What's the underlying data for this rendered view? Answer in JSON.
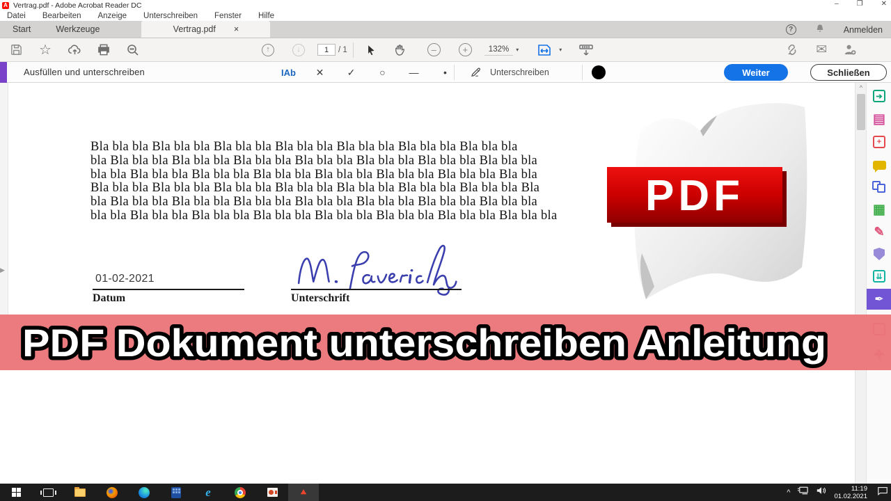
{
  "window": {
    "title": "Vertrag.pdf - Adobe Acrobat Reader DC",
    "logo_letter": "A",
    "minimize_glyph": "–",
    "restore_glyph": "❐",
    "close_glyph": "✕"
  },
  "menu_bar": {
    "items": [
      "Datei",
      "Bearbeiten",
      "Anzeige",
      "Unterschreiben",
      "Fenster",
      "Hilfe"
    ]
  },
  "tab_bar": {
    "tab_start": "Start",
    "tab_tools": "Werkzeuge",
    "tab_document": "Vertrag.pdf",
    "tab_close_glyph": "×",
    "help_glyph": "?",
    "sign_in": "Anmelden"
  },
  "toolbar": {
    "star_glyph": "☆",
    "page_up_glyph": "↑",
    "page_down_glyph": "↓",
    "page_current": "1",
    "page_total": "/ 1",
    "zoom_out_glyph": "–",
    "zoom_in_glyph": "+",
    "zoom_level": "132%",
    "dropdown_glyph": "▾",
    "envelope_glyph": "✉"
  },
  "fill_sign_bar": {
    "title": "Ausfüllen und unterschreiben",
    "text_tool": "IAb",
    "cross_tool": "✕",
    "check_tool": "✓",
    "circle_tool": "○",
    "line_tool": "—",
    "dot_tool": "•",
    "sign_label": "Unterschreiben",
    "next_button": "Weiter",
    "close_button": "Schließen"
  },
  "document": {
    "panel_handle_glyph": "▶",
    "scroll_top_glyph": "^",
    "lines": [
      "Bla bla bla Bla bla bla Bla bla bla Bla bla bla Bla bla bla Bla bla bla Bla bla bla",
      "bla Bla bla bla Bla bla bla Bla bla bla Bla bla bla Bla bla bla Bla bla bla Bla bla bla",
      "bla bla Bla bla bla Bla bla bla Bla bla bla Bla bla bla Bla bla bla Bla bla bla Bla bla",
      "Bla bla bla Bla bla bla Bla bla bla Bla bla bla Bla bla bla Bla bla bla Bla bla bla Bla",
      "bla Bla bla bla Bla bla bla Bla bla bla Bla bla bla Bla bla bla Bla bla bla Bla bla bla",
      "bla bla Bla bla bla Bla bla bla Bla bla bla Bla bla bla Bla bla bla Bla bla bla Bla bla bla"
    ],
    "date_value": "01-02-2021",
    "date_label": "Datum",
    "signature_label": "Unterschrift",
    "signature_name": "M. Paverich"
  },
  "pdf_badge": {
    "label": "PDF"
  },
  "tools_rail": {
    "export_glyph": "➔",
    "edit_glyph": "▤",
    "create_glyph": "+",
    "organize_glyph": "▦",
    "fill_sign_glyph": "✎",
    "compress_glyph": "⇊",
    "certificates_glyph": "✒"
  },
  "banner": {
    "text": "PDF Dokument unterschreiben Anleitung",
    "background": "#ea7376"
  },
  "taskbar": {
    "ie_glyph": "e",
    "tray_chevron_glyph": "^",
    "time": "11:19",
    "date": "01.02.2021"
  },
  "colors": {
    "accent_purple": "#7a42c8",
    "rail_active_purple": "#7155d4",
    "button_blue": "#1473e6",
    "pdf_red": "#d60000",
    "banner_red": "#ea7376"
  }
}
